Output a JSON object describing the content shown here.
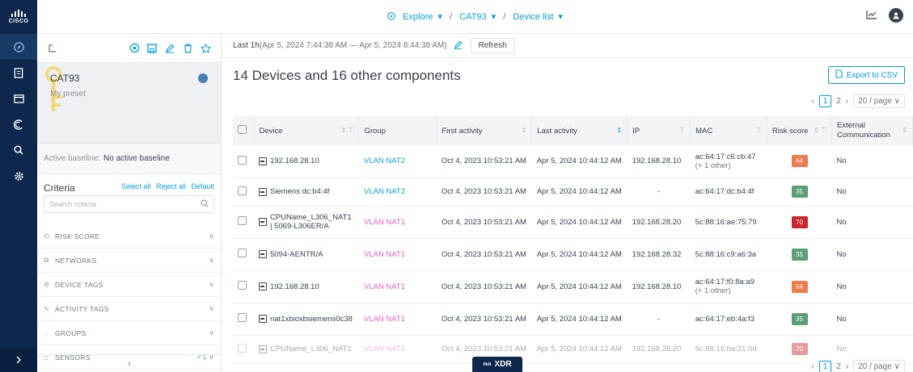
{
  "brand": {
    "logo_text": "CISCO"
  },
  "topbar": {
    "explore": "Explore",
    "preset": "CAT93",
    "page": "Device list"
  },
  "panel": {
    "preset_name": "CAT93",
    "preset_desc": "My preset",
    "baseline_label": "Active baseline:",
    "baseline_value": "No active baseline",
    "criteria_title": "Criteria",
    "select_all": "Select all",
    "reject_all": "Reject all",
    "default": "Default",
    "search_placeholder": "Search criteria",
    "criteria": [
      {
        "label": "RISK SCORE",
        "icon": "gauge-icon"
      },
      {
        "label": "NETWORKS",
        "icon": "network-icon"
      },
      {
        "label": "DEVICE TAGS",
        "icon": "tag-icon"
      },
      {
        "label": "ACTIVITY TAGS",
        "icon": "activity-icon"
      },
      {
        "label": "GROUPS",
        "icon": "group-icon"
      },
      {
        "label": "SENSORS",
        "icon": "sensor-icon",
        "count": "1"
      }
    ]
  },
  "main": {
    "range_prefix": "Last 1h",
    "range_text": "(Apr 5, 2024 7:44:38 AM — Apr 5, 2024 8:44:38 AM)",
    "refresh": "Refresh",
    "heading": "14 Devices and 16 other components",
    "export": "Export to CSV",
    "pager": {
      "current": "1",
      "next": "2",
      "size": "20 / page"
    },
    "columns": [
      "Device",
      "Group",
      "First activity",
      "Last activity",
      "IP",
      "MAC",
      "Risk score",
      "External Communication"
    ],
    "rows": [
      {
        "device": "192.168.28.10",
        "group": "VLAN NAT2",
        "gtype": "2",
        "first": "Oct 4, 2023 10:53:21 AM",
        "last": "Apr 5, 2024 10:44:12 AM",
        "ip": "192.168.28.10",
        "mac": "ac:64:17:c6:cb:47",
        "mac2": "(+ 1 other)",
        "risk": "64",
        "riskColor": "#ef7c4e",
        "ext": "No",
        "tall": true
      },
      {
        "device": "Siemens dc:b4:4f",
        "group": "VLAN NAT2",
        "gtype": "2",
        "first": "Oct 4, 2023 10:53:21 AM",
        "last": "Apr 5, 2024 10:44:12 AM",
        "ip": "-",
        "mac": "ac:64:17:dc:b4:4f",
        "mac2": "",
        "risk": "35",
        "riskColor": "#5b9e78",
        "ext": "No",
        "tall": false
      },
      {
        "device": "CPUName_L306_NAT1 | 5069-L306ER/A",
        "group": "VLAN NAT1",
        "gtype": "1",
        "first": "Oct 4, 2023 10:53:21 AM",
        "last": "Apr 5, 2024 10:44:12 AM",
        "ip": "192.168.28.20",
        "mac": "5c:88:16:ae:75:79",
        "mac2": "",
        "risk": "70",
        "riskColor": "#c8242c",
        "ext": "No",
        "tall": true
      },
      {
        "device": "5094-AENTR/A",
        "group": "VLAN NAT1",
        "gtype": "1",
        "first": "Oct 4, 2023 10:53:21 AM",
        "last": "Apr 5, 2024 10:44:12 AM",
        "ip": "192.168.28.32",
        "mac": "5c:88:16:c9:a6:3a",
        "mac2": "",
        "risk": "35",
        "riskColor": "#5b9e78",
        "ext": "No",
        "tall": true
      },
      {
        "device": "192.168.28.10",
        "group": "VLAN NAT1",
        "gtype": "1",
        "first": "Oct 4, 2023 10:53:21 AM",
        "last": "Apr 5, 2024 10:44:12 AM",
        "ip": "192.168.28.10",
        "mac": "ac:64:17:f0:8a:a9",
        "mac2": "(+ 1 other)",
        "risk": "64",
        "riskColor": "#ef7c4e",
        "ext": "No",
        "tall": true
      },
      {
        "device": "nat1xbioxbsiemens0c38",
        "group": "VLAN NAT1",
        "gtype": "1",
        "first": "Oct 4, 2023 10:53:21 AM",
        "last": "Apr 5, 2024 10:44:12 AM",
        "ip": "-",
        "mac": "ac:64:17:eb:4a:f3",
        "mac2": "",
        "risk": "35",
        "riskColor": "#5b9e78",
        "ext": "No",
        "tall": true
      },
      {
        "device": "CPUName_L306_NAT1",
        "group": "VLAN NAT2",
        "gtype": "1",
        "first": "Oct 4, 2023 10:53:21 AM",
        "last": "Apr 5, 2024 10:44:12 AM",
        "ip": "192.168.28.20",
        "mac": "5c:88:16:ba:21:0d",
        "mac2": "",
        "risk": "70",
        "riskColor": "#c8242c",
        "ext": "No",
        "tall": false,
        "faded": true
      }
    ]
  },
  "xdr": {
    "label": "XDR"
  }
}
